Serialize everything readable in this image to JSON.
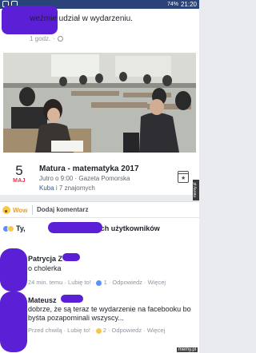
{
  "status_bar": {
    "battery": "74%",
    "time": "21:20"
  },
  "post": {
    "share_text": "weźmie udział w wydarzeniu.",
    "age": "1 godz.",
    "event": {
      "day": "5",
      "month": "MAJ",
      "title": "Matura - matematyka 2017",
      "time_place": "Jutro o 9:00 · Gazeta Pomorska",
      "friend_name": "Kuba",
      "friends_rest": " i 7 znajomych"
    }
  },
  "actions": {
    "wow": "Wow",
    "comment": "Dodaj komentarz"
  },
  "reactions": {
    "text_start": "Ty, ",
    "text_end": "ka i 2 innych użytkowników"
  },
  "comments": [
    {
      "name": "Patrycja Z",
      "text": "o cholerka",
      "meta": "24 min. temu · Lubię to! · ",
      "reactions_count": "1",
      "meta_end": " · Odpowiedz · Więcej"
    },
    {
      "name": "Mateusz",
      "text": "dobrze, że są teraz te wydarzenie na facebooku bo byśta pozapominali wszyscy...",
      "meta": "Przed chwilą · Lubię to! · ",
      "reactions_count": "2",
      "meta_end": " · Odpowiedz · Więcej"
    }
  ],
  "watermarks": {
    "side": "memy.pl",
    "bottom": "memy.pl"
  }
}
